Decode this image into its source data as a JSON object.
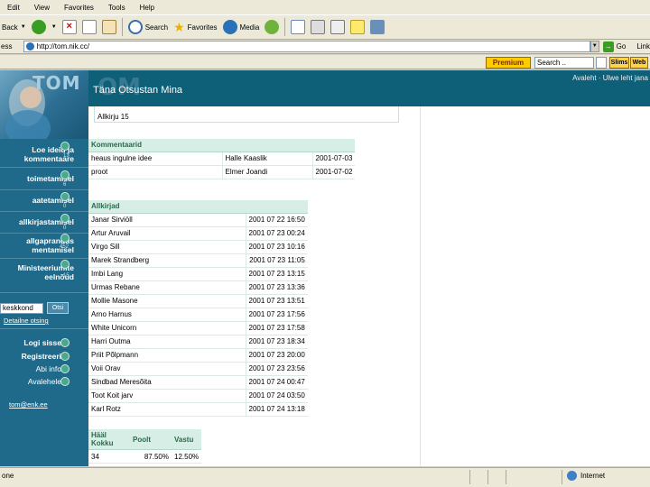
{
  "browser": {
    "menu": [
      "Edit",
      "View",
      "Favorites",
      "Tools",
      "Help"
    ],
    "toolbar": {
      "back": "Back",
      "search": "Search",
      "favorites": "Favorites",
      "media": "Media"
    },
    "address": {
      "label": "ess",
      "url": "http://tom.nik.cc/",
      "go": "Go",
      "links": "Link"
    },
    "search_toolbar": {
      "premium": "Premium",
      "placeholder": "Search ..",
      "slims": "Slims",
      "web": "Web"
    },
    "status": {
      "left": "one",
      "zone": "Internet"
    }
  },
  "site": {
    "logo": "TOM",
    "title": "Täna Otsustan Mina",
    "top_links": "Avaleht · Ulwe leht jana",
    "sidebar": {
      "items": [
        {
          "label": "Loe ideid ja kommentaare",
          "count": "13"
        },
        {
          "label": "toimetamisel",
          "count": "6"
        },
        {
          "label": "aatetamisel",
          "count": "0"
        },
        {
          "label": "allkirjastamisel",
          "count": "0"
        },
        {
          "label": "allgaprandus mentamisel",
          "count": "452"
        },
        {
          "label": "Ministeeriumite eelnõud",
          "count": "15"
        }
      ],
      "search_value": "keskkond",
      "search_button": "Otsi",
      "detail_search": "Detailne otsing",
      "login": [
        "Logi sisse",
        "Registreeri",
        "Abi info",
        "Avalehele"
      ],
      "footer_link": "tom@enk.ee"
    },
    "allkirju": "Allkirju 15",
    "comments": {
      "header": "Kommentaarid",
      "rows": [
        {
          "title": "heaus ingulne idee",
          "author": "Halle Kaaslik",
          "date": "2001-07-03"
        },
        {
          "title": "proot",
          "author": "Elmer Joandi",
          "date": "2001-07-02"
        }
      ]
    },
    "signatures": {
      "header": "Allkirjad",
      "rows": [
        {
          "name": "Janar Sirviöll",
          "time": "2001 07 22 16:50"
        },
        {
          "name": "Artur Aruvail",
          "time": "2001 07 23 00:24"
        },
        {
          "name": "Virgo Sill",
          "time": "2001 07 23 10:16"
        },
        {
          "name": "Marek Strandberg",
          "time": "2001 07 23 11:05"
        },
        {
          "name": "Imbi Lang",
          "time": "2001 07 23 13:15"
        },
        {
          "name": "Urmas Rebane",
          "time": "2001 07 23 13:36"
        },
        {
          "name": "Mollie Masone",
          "time": "2001 07 23 13:51"
        },
        {
          "name": "Arno Harnus",
          "time": "2001 07 23 17:56"
        },
        {
          "name": "White Unicorn",
          "time": "2001 07 23 17:58"
        },
        {
          "name": "Harri Outma",
          "time": "2001 07 23 18:34"
        },
        {
          "name": "Priit Põlpmann",
          "time": "2001 07 23 20:00"
        },
        {
          "name": "Voii Orav",
          "time": "2001 07 23 23:56"
        },
        {
          "name": "Sindbad Meresõita",
          "time": "2001 07 24 00:47"
        },
        {
          "name": "Toot Koit jarv",
          "time": "2001 07 24 03:50"
        },
        {
          "name": "Karl Rotz",
          "time": "2001 07 24 13:18"
        }
      ]
    },
    "votes": {
      "headers": [
        "Hääl Kokku",
        "Poolt",
        "Vastu"
      ],
      "values": [
        "34",
        "87.50%",
        "12.50%"
      ]
    }
  }
}
